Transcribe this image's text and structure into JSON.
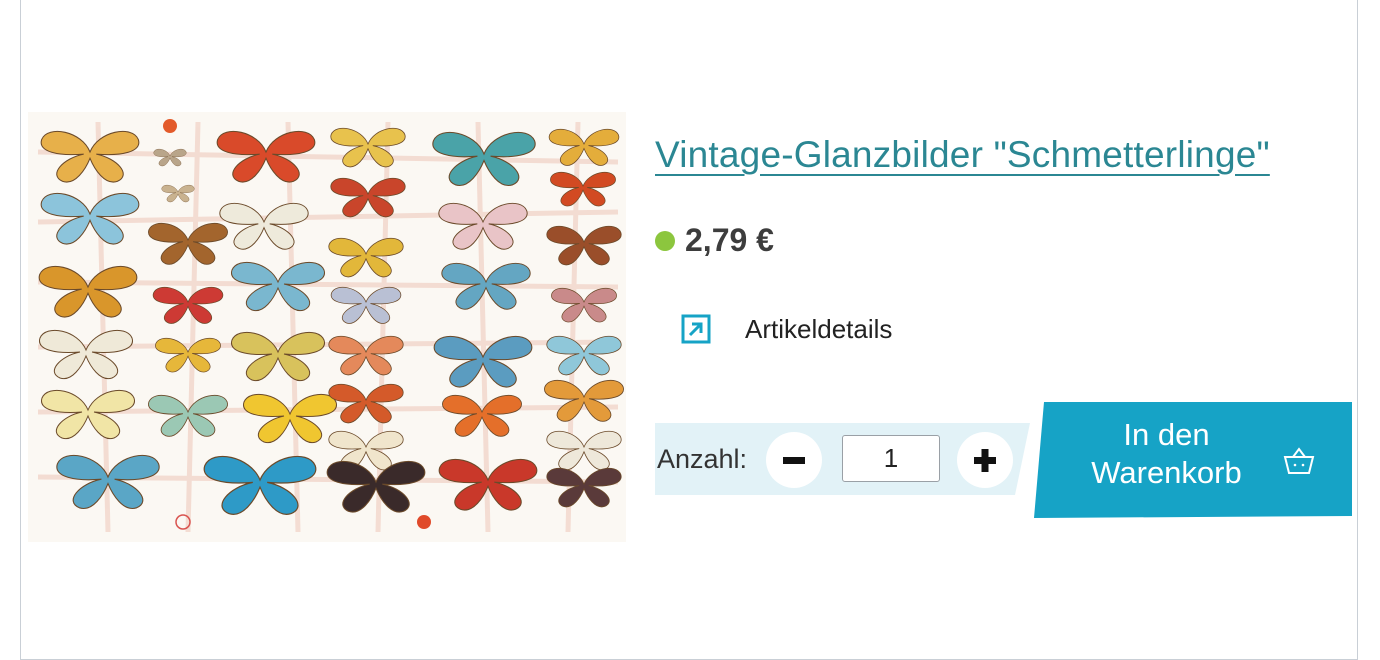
{
  "product": {
    "title": "Vintage-Glanzbilder \"Schmetterlinge\"",
    "price": "2,79 €",
    "availability_color": "#8cc63e",
    "details_label": "Artikeldetails",
    "details_icon": "external-link-icon"
  },
  "purchase": {
    "quantity_label": "Anzahl:",
    "quantity_value": "1",
    "decrease_icon": "minus-icon",
    "increase_icon": "plus-icon",
    "cart_label_line1": "In den",
    "cart_label_line2": "Warenkorb",
    "cart_icon": "basket-icon",
    "accent_color": "#16a3c6"
  }
}
